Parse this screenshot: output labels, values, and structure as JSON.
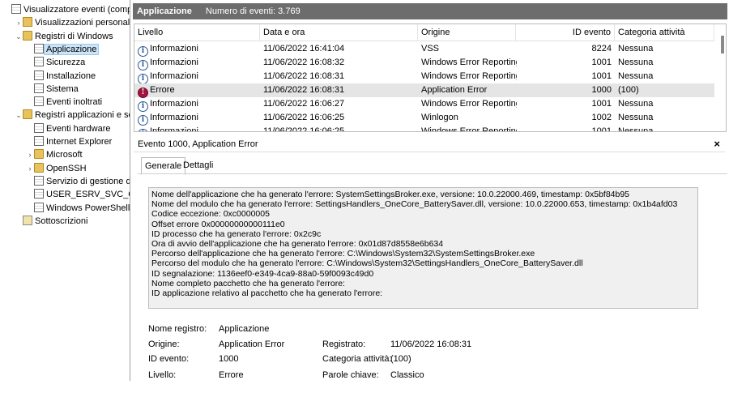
{
  "tree": {
    "items": [
      {
        "label": "Visualizzatore eventi (computer",
        "level": 0,
        "arrow": "",
        "icon": "log"
      },
      {
        "label": "Visualizzazioni personalizzate",
        "level": 1,
        "arrow": "›",
        "icon": "custom"
      },
      {
        "label": "Registri di Windows",
        "level": 1,
        "arrow": "⌄",
        "icon": "folder"
      },
      {
        "label": "Applicazione",
        "level": 2,
        "arrow": "",
        "icon": "log",
        "selected": true
      },
      {
        "label": "Sicurezza",
        "level": 2,
        "arrow": "",
        "icon": "log"
      },
      {
        "label": "Installazione",
        "level": 2,
        "arrow": "",
        "icon": "log"
      },
      {
        "label": "Sistema",
        "level": 2,
        "arrow": "",
        "icon": "log"
      },
      {
        "label": "Eventi inoltrati",
        "level": 2,
        "arrow": "",
        "icon": "log"
      },
      {
        "label": "Registri applicazioni e servizi",
        "level": 1,
        "arrow": "⌄",
        "icon": "folder"
      },
      {
        "label": "Eventi hardware",
        "level": 2,
        "arrow": "",
        "icon": "log"
      },
      {
        "label": "Internet Explorer",
        "level": 2,
        "arrow": "",
        "icon": "log"
      },
      {
        "label": "Microsoft",
        "level": 2,
        "arrow": "›",
        "icon": "folder"
      },
      {
        "label": "OpenSSH",
        "level": 2,
        "arrow": "›",
        "icon": "folder"
      },
      {
        "label": "Servizio di gestione delle",
        "level": 2,
        "arrow": "",
        "icon": "log"
      },
      {
        "label": "USER_ESRV_SVC_QUEENC",
        "level": 2,
        "arrow": "",
        "icon": "log"
      },
      {
        "label": "Windows PowerShell",
        "level": 2,
        "arrow": "",
        "icon": "log"
      },
      {
        "label": "Sottoscrizioni",
        "level": 1,
        "arrow": "",
        "icon": "sub"
      }
    ]
  },
  "header": {
    "title": "Applicazione",
    "count_text": "Numero di eventi: 3.769"
  },
  "grid": {
    "columns": [
      "Livello",
      "Data e ora",
      "Origine",
      "ID evento",
      "Categoria attività"
    ],
    "rows": [
      {
        "level": "Informazioni",
        "type": "info",
        "date": "11/06/2022 16:41:04",
        "source": "VSS",
        "id": "8224",
        "cat": "Nessuna"
      },
      {
        "level": "Informazioni",
        "type": "info",
        "date": "11/06/2022 16:08:32",
        "source": "Windows Error Reporting",
        "id": "1001",
        "cat": "Nessuna"
      },
      {
        "level": "Informazioni",
        "type": "info",
        "date": "11/06/2022 16:08:31",
        "source": "Windows Error Reporting",
        "id": "1001",
        "cat": "Nessuna"
      },
      {
        "level": "Errore",
        "type": "error",
        "date": "11/06/2022 16:08:31",
        "source": "Application Error",
        "id": "1000",
        "cat": "(100)",
        "selected": true
      },
      {
        "level": "Informazioni",
        "type": "info",
        "date": "11/06/2022 16:06:27",
        "source": "Windows Error Reporting",
        "id": "1001",
        "cat": "Nessuna"
      },
      {
        "level": "Informazioni",
        "type": "info",
        "date": "11/06/2022 16:06:25",
        "source": "Winlogon",
        "id": "1002",
        "cat": "Nessuna"
      },
      {
        "level": "Informazioni",
        "type": "info",
        "date": "11/06/2022 16:06:25",
        "source": "Windows Error Reporting",
        "id": "1001",
        "cat": "Nessuna"
      }
    ]
  },
  "detail": {
    "title": "Evento 1000, Application Error",
    "close": "×",
    "tabs": [
      "Generale",
      "Dettagli"
    ],
    "message_lines": [
      "Nome dell'applicazione che ha generato l'errore: SystemSettingsBroker.exe, versione: 10.0.22000.469, timestamp: 0x5bf84b95",
      "Nome del modulo che ha generato l'errore: SettingsHandlers_OneCore_BatterySaver.dll, versione: 10.0.22000.653, timestamp: 0x1b4afd03",
      "Codice eccezione: 0xc0000005",
      "Offset errore 0x00000000000111e0",
      "ID processo che ha generato l'errore: 0x2c9c",
      "Ora di avvio dell'applicazione che ha generato l'errore: 0x01d87d8558e6b634",
      "Percorso dell'applicazione che ha generato l'errore: C:\\Windows\\System32\\SystemSettingsBroker.exe",
      "Percorso del modulo che ha generato l'errore: C:\\Windows\\System32\\SettingsHandlers_OneCore_BatterySaver.dll",
      "ID segnalazione: 1136eef0-e349-4ca9-88a0-59f0093c49d0",
      "Nome completo pacchetto che ha generato l'errore:",
      "ID applicazione relativo al pacchetto che ha generato l'errore:"
    ],
    "props": {
      "log_name_label": "Nome registro:",
      "log_name": "Applicazione",
      "source_label": "Origine:",
      "source": "Application Error",
      "logged_label": "Registrato:",
      "logged": "11/06/2022 16:08:31",
      "event_id_label": "ID evento:",
      "event_id": "1000",
      "task_label": "Categoria attività:",
      "task": "(100)",
      "level_label": "Livello:",
      "level": "Errore",
      "keywords_label": "Parole chiave:",
      "keywords": "Classico"
    }
  }
}
